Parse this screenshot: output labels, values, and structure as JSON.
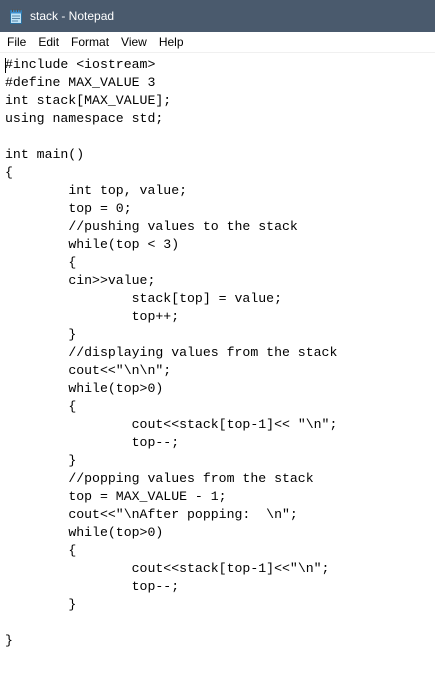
{
  "window": {
    "title": "stack - Notepad",
    "icon": "notepad-icon",
    "titlebar_color": "#4a5a6d"
  },
  "menu": {
    "file": "File",
    "edit": "Edit",
    "format": "Format",
    "view": "View",
    "help": "Help"
  },
  "editor": {
    "content": "#include <iostream>\n#define MAX_VALUE 3\nint stack[MAX_VALUE];\nusing namespace std;\n\nint main()\n{\n\tint top, value;\n\ttop = 0;\n\t//pushing values to the stack\n\twhile(top < 3)\n\t{\n\tcin>>value;\n\t\tstack[top] = value;\n\t\ttop++;\n\t}\n\t//displaying values from the stack\n\tcout<<\"\\n\\n\";\n\twhile(top>0)\n\t{\n\t\tcout<<stack[top-1]<< \"\\n\";\n\t\ttop--;\n\t}\n\t//popping values from the stack\n\ttop = MAX_VALUE - 1;\n\tcout<<\"\\nAfter popping:  \\n\";\n\twhile(top>0)\n\t{\n\t\tcout<<stack[top-1]<<\"\\n\";\n\t\ttop--;\n\t}\n\n}"
  }
}
